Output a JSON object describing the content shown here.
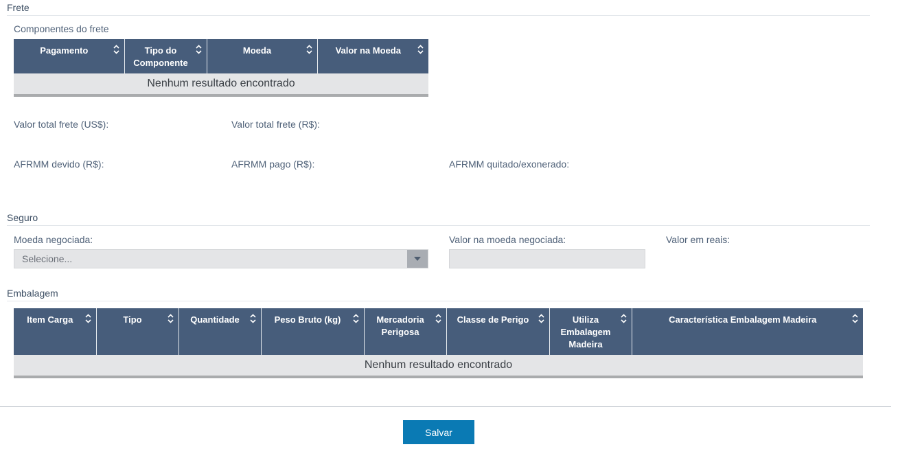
{
  "frete": {
    "title": "Frete",
    "componentes_label": "Componentes do frete",
    "columns": [
      "Pagamento",
      "Tipo do Componente",
      "Moeda",
      "Valor na Moeda"
    ],
    "empty_message": "Nenhum resultado encontrado",
    "valor_total_usd_label": "Valor total frete (US$):",
    "valor_total_brl_label": "Valor total frete (R$):",
    "afrmm_devido_label": "AFRMM devido (R$):",
    "afrmm_pago_label": "AFRMM pago (R$):",
    "afrmm_quitado_label": "AFRMM quitado/exonerado:"
  },
  "seguro": {
    "title": "Seguro",
    "moeda_label": "Moeda negociada:",
    "moeda_placeholder": "Selecione...",
    "valor_moeda_label": "Valor na moeda negociada:",
    "valor_reais_label": "Valor em reais:",
    "valor_moeda_value": ""
  },
  "embalagem": {
    "title": "Embalagem",
    "columns": [
      "Item Carga",
      "Tipo",
      "Quantidade",
      "Peso Bruto (kg)",
      "Mercadoria Perigosa",
      "Classe de Perigo",
      "Utiliza Embalagem Madeira",
      "Característica Embalagem Madeira"
    ],
    "empty_message": "Nenhum resultado encontrado"
  },
  "footer": {
    "save_label": "Salvar"
  },
  "colors": {
    "header_bg": "#475d7b",
    "primary_button": "#0a7ab4"
  },
  "icons": {
    "sort": "sort-icon",
    "dropdown": "caret-down-icon"
  }
}
